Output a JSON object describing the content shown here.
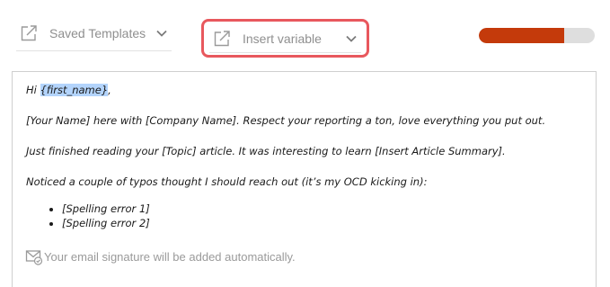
{
  "toolbar": {
    "saved_templates": {
      "label": "Saved Templates",
      "icon": "external-link-icon"
    },
    "insert_variable": {
      "label": "Insert variable",
      "icon": "external-link-icon",
      "highlight_color": "#e8585d"
    },
    "progress": {
      "fraction": 0.74,
      "fill_color": "#c43a0b",
      "track_color": "#dedede"
    }
  },
  "editor": {
    "greeting_prefix": "Hi ",
    "greeting_variable": "{first_name}",
    "greeting_suffix": ",",
    "paragraphs": [
      "[Your Name] here with [Company Name]. Respect your reporting a ton, love everything you put out.",
      "Just finished reading your [Topic] article. It was interesting to learn [Insert Article Summary].",
      "Noticed a couple of typos thought I should reach out (it’s my OCD kicking in):"
    ],
    "list_items": [
      "[Spelling error 1]",
      "[Spelling error 2]"
    ]
  },
  "signature": {
    "text": "Your email signature will be added automatically.",
    "icon": "mail-check-icon"
  }
}
